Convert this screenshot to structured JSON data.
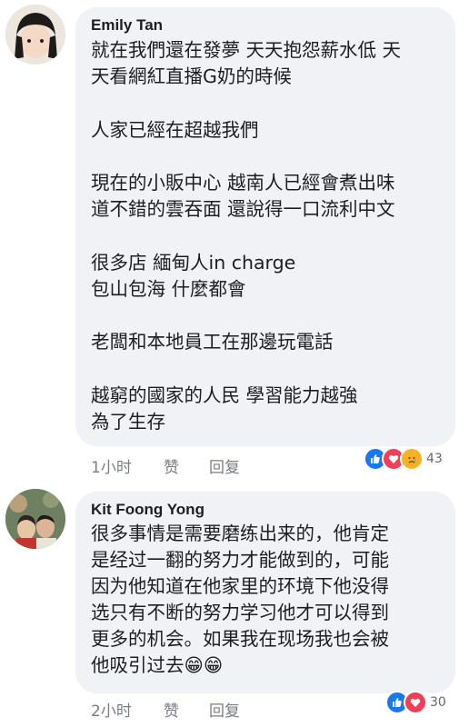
{
  "comments": [
    {
      "author": "Emily Tan",
      "text": "就在我們還在發夢 天天抱怨薪水低 天\n天看網紅直播G奶的時候\n\n人家已經在超越我們\n\n現在的小販中心 越南人已經會煮出味\n道不錯的雲吞面 還說得一口流利中文\n\n很多店 緬甸人in charge\n包山包海 什麼都會\n\n老闆和本地員工在那邊玩電話\n\n越窮的國家的人民 學習能力越強\n為了生存",
      "time": "1小时",
      "like_label": "赞",
      "reply_label": "回复",
      "reactions": [
        "like",
        "love",
        "sad"
      ],
      "reaction_count": "43"
    },
    {
      "author": "Kit Foong Yong",
      "text": "很多事情是需要磨练出来的，他肯定\n是经过一翻的努力才能做到的，可能\n因为他知道在他家里的环境下他没得\n选只有不断的努力学习他才可以得到\n更多的机会。如果我在现场我也会被\n他吸引过去😁😁",
      "time": "2小时",
      "like_label": "赞",
      "reply_label": "回复",
      "reactions": [
        "like",
        "love"
      ],
      "reaction_count": "30"
    }
  ],
  "colors": {
    "bubble": "#f0f2f5",
    "like": "#1877f2",
    "love": "#f33e58",
    "sad": "#f7b125",
    "meta": "#7a7d83"
  }
}
